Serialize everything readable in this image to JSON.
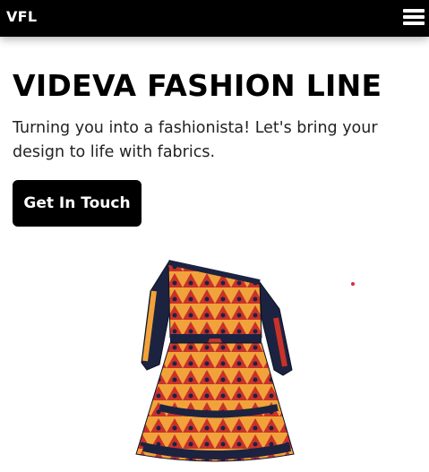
{
  "nav": {
    "brand": "VFL",
    "menu_icon": "hamburger-menu-icon"
  },
  "hero": {
    "title": "VIDEVA FASHION LINE",
    "subtitle": "Turning you into a fashionista! Let's bring your design to life with fabrics.",
    "cta_label": "Get In Touch"
  },
  "colors": {
    "nav_bg": "#000000",
    "button_bg": "#000000",
    "dress_navy": "#1c2340",
    "dress_orange": "#f2a23a",
    "dress_red": "#c8322a"
  }
}
